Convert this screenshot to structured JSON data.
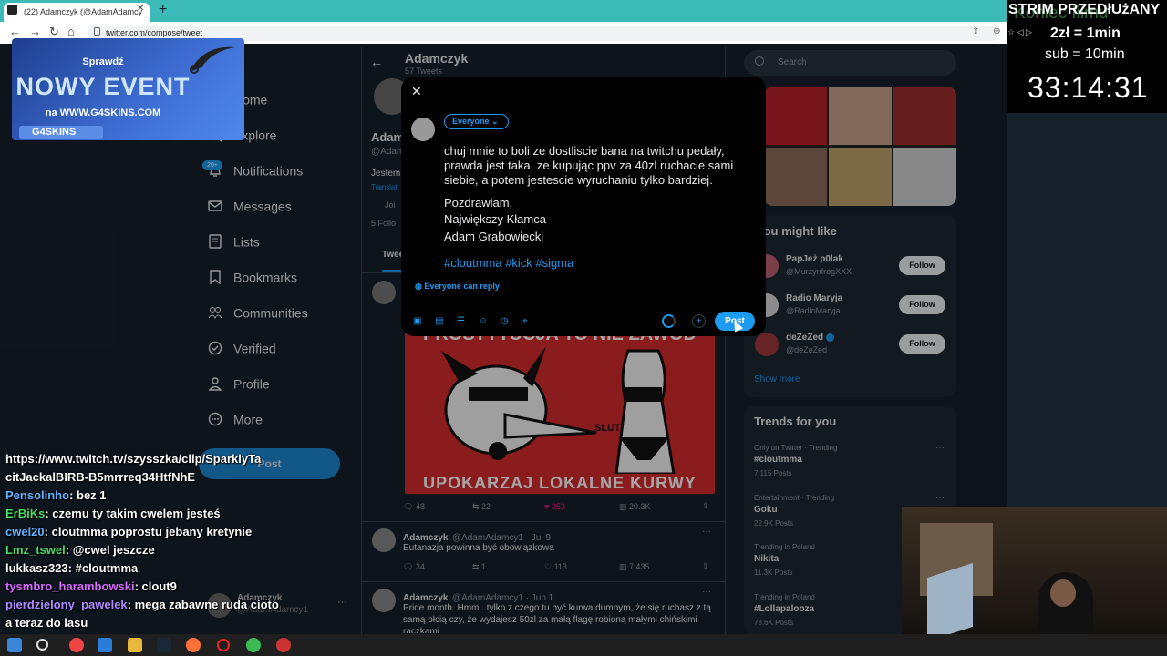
{
  "browser": {
    "tab_title": "(22) Adamczyk (@AdamAdamcy",
    "url": "twitter.com/compose/tweet"
  },
  "banner": {
    "line1": "Sprawdź",
    "line2": "NOWY EVENT",
    "line3": "na WWW.G4SKINS.COM",
    "logo": "G4SKINS"
  },
  "nav": {
    "home": "Home",
    "explore": "Explore",
    "notifications": "Notifications",
    "notif_badge": "20+",
    "messages": "Messages",
    "lists": "Lists",
    "bookmarks": "Bookmarks",
    "communities": "Communities",
    "verified": "Verified",
    "profile": "Profile",
    "more": "More",
    "post": "Post",
    "account_name": "Adamczyk",
    "account_handle": "@AdamAdamcy1"
  },
  "chat": [
    {
      "user": "",
      "color": "#ffffff",
      "text": "https://www.twitch.tv/szysszka/clip/SparklyTa"
    },
    {
      "user": "",
      "color": "#ffffff",
      "text": "citJackalBIRB-B5mrrreq34HtfNhE"
    },
    {
      "user": "Pensolinho",
      "color": "#5fb3ff",
      "text": ": bez 1"
    },
    {
      "user": "ErBiKs",
      "color": "#4cd964",
      "text": ": czemu ty takim cwelem jesteś"
    },
    {
      "user": "cwel20",
      "color": "#5fb3ff",
      "text": ": cloutmma poprostu jebany kretynie"
    },
    {
      "user": "Lmz_tswel",
      "color": "#4cd964",
      "text": ": @cwel jeszcze"
    },
    {
      "user": "lukkasz323",
      "color": "#ffffff",
      "text": ": #cloutmma"
    },
    {
      "user": "tysmbro_harambowski",
      "color": "#d66cff",
      "text": ": clout9"
    },
    {
      "user": "pierdzielony_pawelek",
      "color": "#b08bff",
      "text": ": mega zabawne ruda cioto"
    },
    {
      "user": "",
      "color": "#ffffff",
      "text": "a teraz       do lasu"
    }
  ],
  "profile": {
    "name": "Adamczyk",
    "tweet_count": "57 Tweets",
    "bio_name": "Adam",
    "bio_handle": "@Adam",
    "bio_text": "Jestem",
    "bio_translate": "Translat",
    "bio_joined": "Joi",
    "bio_followers": "5 Follo",
    "tab_tweets": "Twee"
  },
  "meme": {
    "top_text": "PROSTYTUCJA TO NIE ZAWÓD",
    "label": "SLUT",
    "bottom_text": "UPOKARZAJ LOKALNE KURWY"
  },
  "tweet1_actions": {
    "replies": "48",
    "retweets": "22",
    "likes": "353",
    "views": "20.3K"
  },
  "tweets": [
    {
      "name": "Adamczyk",
      "meta": "@AdamAdamcy1 · Jul 9",
      "text": "Eutanazja powinna być obowiązkowa",
      "replies": "34",
      "retweets": "1",
      "likes": "113",
      "views": "7,435"
    },
    {
      "name": "Adamczyk",
      "meta": "@AdamAdamcy1 · Jun 1",
      "text": "Pride month. Hmm.. tylko z czego tu być kurwa dumnym, że się ruchasz z tą samą płcią czy, że wydajesz 50zl za małą flagę robioną małymi chińskimi rączkami"
    }
  ],
  "right": {
    "search_placeholder": "Search",
    "wtf_title": "You might like",
    "suggestions": [
      {
        "name": "PapJeż p0lak",
        "handle": "@MurzynfrogXXX",
        "follow": "Follow"
      },
      {
        "name": "Radio Maryja",
        "handle": "@RadioMaryja",
        "follow": "Follow"
      },
      {
        "name": "deZeZed",
        "handle": "@deZeZed",
        "follow": "Follow"
      }
    ],
    "show_more": "Show more",
    "trends_title": "Trends for you",
    "trends": [
      {
        "category": "Only on Twitter · Trending",
        "name": "#cloutmma",
        "count": "7,115 Posts"
      },
      {
        "category": "Entertainment · Trending",
        "name": "Goku",
        "count": "22.9K Posts"
      },
      {
        "category": "Trending in Poland",
        "name": "Nikita",
        "count": "11.3K Posts"
      },
      {
        "category": "Trending in Poland",
        "name": "#Lollapalooza",
        "count": "78.6K Posts"
      }
    ]
  },
  "compose": {
    "audience": "Everyone",
    "text": "chuj mnie to boli ze dostliscie bana na twitchu pedały, prawda jest taka, ze kupując ppv za 40zl ruchacie sami siebie, a potem jestescie wyruchaniu tylko bardziej.",
    "greeting": "Pozdrawiam,",
    "sig1": "Największy Kłamca",
    "sig2": "Adam Grabowiecki",
    "tags": "#cloutmma #kick #sigma",
    "reply_setting": "Everyone can reply",
    "post_button": "Post"
  },
  "stream": {
    "title": "STRIM PRZEDłUżANY",
    "ghost_text": "Koniec filmu",
    "rate": "2zł = 1min",
    "sub": "sub = 10min",
    "timer": "33:14:31"
  },
  "colors": {
    "accent": "#1d9bf0",
    "bg": "#15202b",
    "banner_blue": "#3e6ed3"
  }
}
